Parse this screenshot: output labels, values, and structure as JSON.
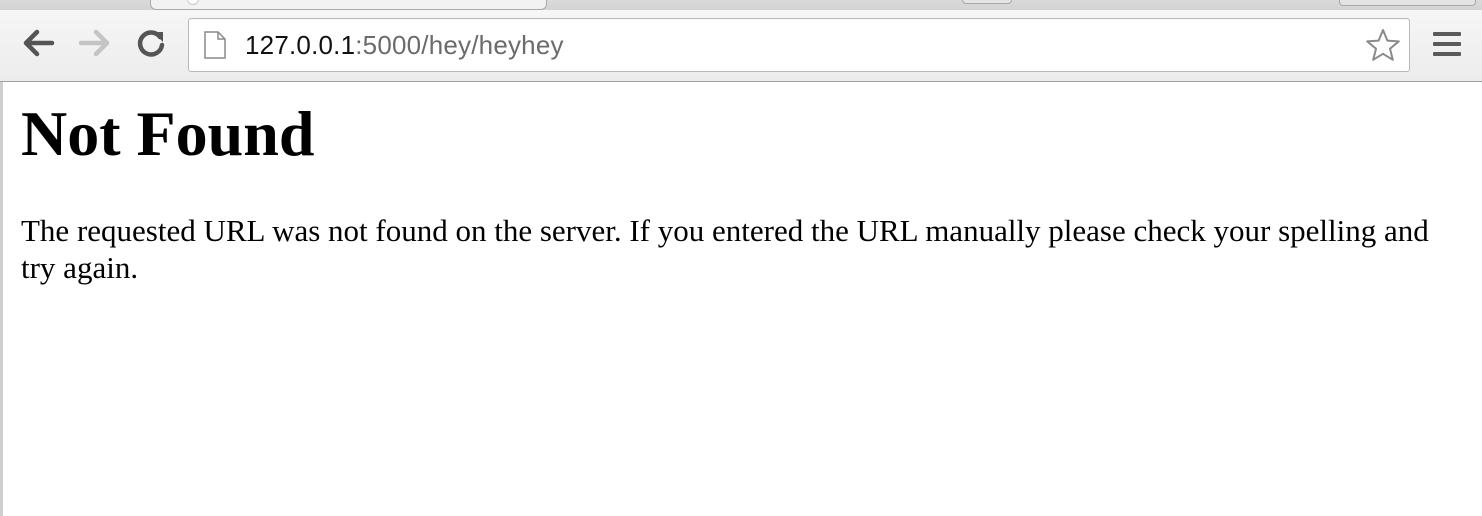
{
  "browser": {
    "url_host": "127.0.0.1",
    "url_rest": ":5000/hey/heyhey",
    "icons": {
      "back": "back-arrow-icon",
      "forward": "forward-arrow-icon",
      "reload": "reload-icon",
      "page": "page-icon",
      "bookmark": "star-icon",
      "menu": "hamburger-menu-icon"
    }
  },
  "page": {
    "heading": "Not Found",
    "message": "The requested URL was not found on the server. If you entered the URL manually please check your spelling and try again."
  },
  "colors": {
    "toolbar": "#f0f0f0",
    "url_host": "#111111",
    "url_path": "#6b6b6b",
    "page_background": "#ffffff",
    "text": "#000000"
  }
}
